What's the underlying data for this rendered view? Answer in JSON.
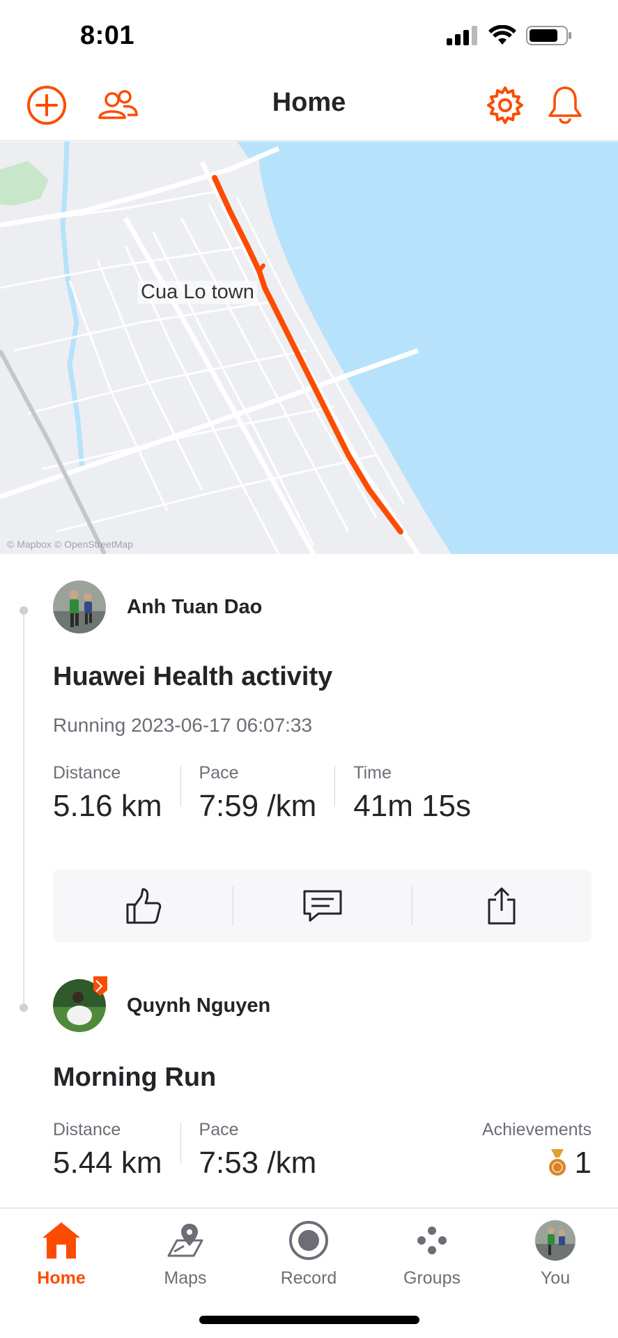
{
  "status_bar": {
    "time": "8:01"
  },
  "header": {
    "title": "Home"
  },
  "map": {
    "place_label": "Cua Lo town",
    "attribution": "© Mapbox © OpenStreetMap"
  },
  "colors": {
    "accent": "#fc4c02",
    "water": "#b6e2fb",
    "text": "#242428",
    "muted": "#6d6d78"
  },
  "feed": {
    "activities": [
      {
        "athlete": "Anh Tuan Dao",
        "title": "Huawei Health activity",
        "meta": "Running 2023-06-17 06:07:33",
        "stats": [
          {
            "label": "Distance",
            "value": "5.16 km"
          },
          {
            "label": "Pace",
            "value": "7:59 /km"
          },
          {
            "label": "Time",
            "value": "41m 15s"
          }
        ],
        "actions": [
          "thumbs-up-icon",
          "comment-icon",
          "share-icon"
        ]
      },
      {
        "athlete": "Quynh Nguyen",
        "title": "Morning Run",
        "stats": [
          {
            "label": "Distance",
            "value": "5.44 km"
          },
          {
            "label": "Pace",
            "value": "7:53 /km"
          }
        ],
        "achievements": {
          "label": "Achievements",
          "count": "1",
          "icon": "medal-icon"
        }
      }
    ]
  },
  "tabs": [
    {
      "label": "Home",
      "icon": "home-icon",
      "active": true
    },
    {
      "label": "Maps",
      "icon": "maps-icon",
      "active": false
    },
    {
      "label": "Record",
      "icon": "record-icon",
      "active": false
    },
    {
      "label": "Groups",
      "icon": "groups-icon",
      "active": false
    },
    {
      "label": "You",
      "icon": "profile-avatar",
      "active": false
    }
  ]
}
